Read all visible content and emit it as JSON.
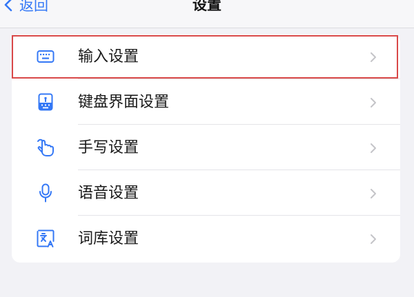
{
  "header": {
    "back_label": "返回",
    "title": "设置"
  },
  "settings_items": [
    {
      "label": "输入设置",
      "icon": "keyboard-icon"
    },
    {
      "label": "键盘界面设置",
      "icon": "keyboard-layout-icon"
    },
    {
      "label": "手写设置",
      "icon": "handwriting-icon"
    },
    {
      "label": "语音设置",
      "icon": "microphone-icon"
    },
    {
      "label": "词库设置",
      "icon": "dictionary-icon"
    }
  ],
  "highlighted_item": "输入设置",
  "colors": {
    "accent": "#3478f6",
    "highlight_border": "#d94848",
    "background": "#f2f2f6"
  }
}
